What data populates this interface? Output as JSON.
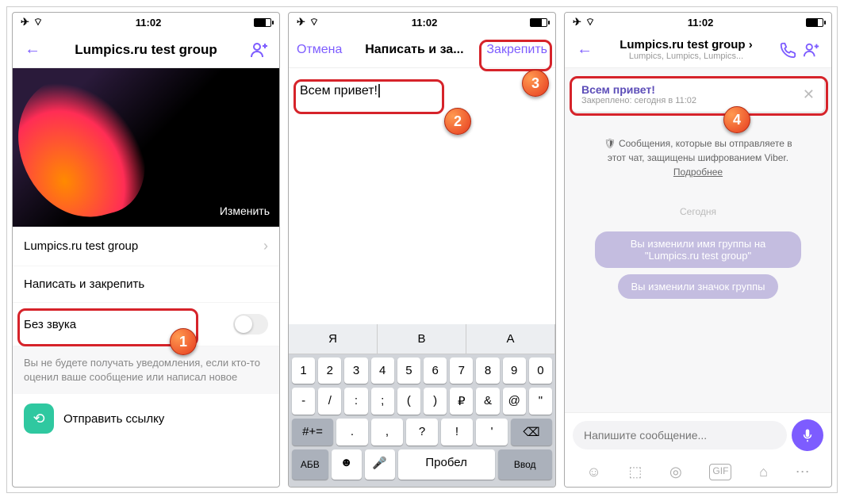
{
  "status": {
    "time": "11:02"
  },
  "s1": {
    "title": "Lumpics.ru test group",
    "edit": "Изменить",
    "groupName": "Lumpics.ru test group",
    "pinWrite": "Написать и закрепить",
    "mute": "Без звука",
    "note": "Вы не будете получать уведомления, если кто-то оценил ваше сообщение или написал новое",
    "share": "Отправить ссылку"
  },
  "s2": {
    "cancel": "Отмена",
    "title": "Написать и за...",
    "pin": "Закрепить",
    "text": "Всем привет!",
    "sugg": [
      "Я",
      "В",
      "А"
    ],
    "r1": [
      "1",
      "2",
      "3",
      "4",
      "5",
      "6",
      "7",
      "8",
      "9",
      "0"
    ],
    "r2": [
      "-",
      "/",
      ":",
      ";",
      "(",
      ")",
      "₽",
      "&",
      "@",
      "\""
    ],
    "space": "Пробел",
    "enter": "Ввод",
    "abc": "АБВ",
    "sym": "#+="
  },
  "s3": {
    "title": "Lumpics.ru test group ›",
    "subtitle": "Lumpics, Lumpics, Lumpics...",
    "pinTitle": "Всем привет!",
    "pinSub": "Закреплено: сегодня в 11:02",
    "enc": "🛡 Сообщения, которые вы отправляете в этот чат, защищены шифрованием Viber. ",
    "encMore": "Подробнее",
    "today": "Сегодня",
    "m1": "Вы изменили имя группы на \"Lumpics.ru test group\"",
    "m2": "Вы изменили значок группы",
    "placeholder": "Напишите сообщение..."
  }
}
